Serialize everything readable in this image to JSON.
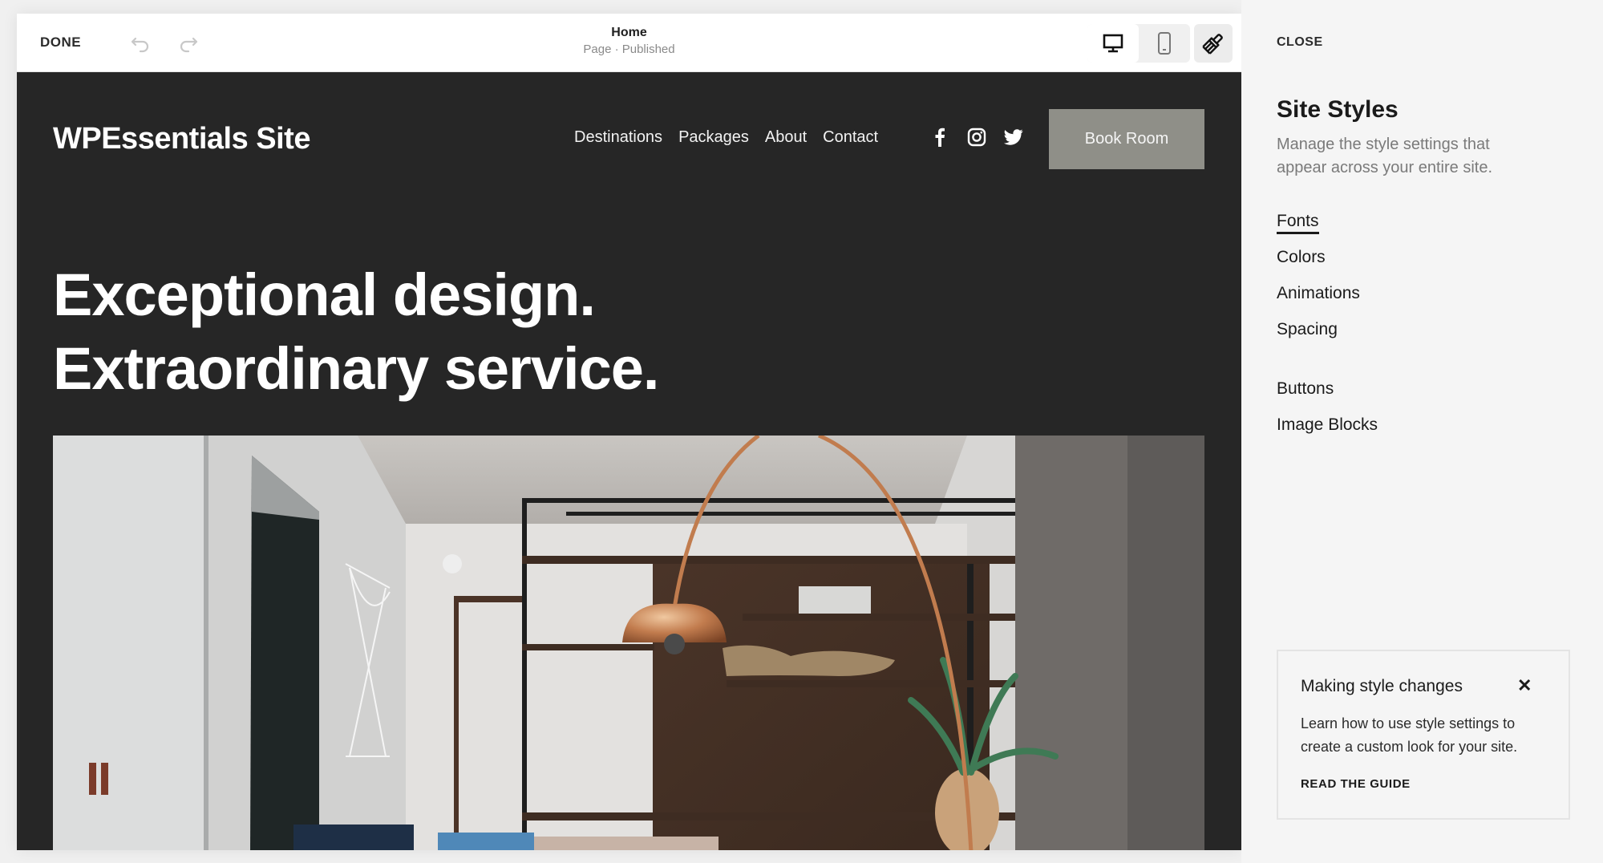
{
  "toolbar": {
    "done_label": "DONE",
    "page_title": "Home",
    "page_status": "Page · Published",
    "undo_icon": "undo-icon",
    "redo_icon": "redo-icon",
    "device_views": [
      {
        "name": "desktop",
        "icon": "desktop-icon",
        "active": true
      },
      {
        "name": "mobile",
        "icon": "mobile-icon",
        "active": false
      }
    ],
    "style_icon": "paintbrush-icon"
  },
  "site": {
    "title": "WPEssentials Site",
    "nav": [
      "Destinations",
      "Packages",
      "About",
      "Contact"
    ],
    "social": [
      "facebook-icon",
      "instagram-icon",
      "twitter-icon"
    ],
    "cta_label": "Book Room",
    "hero_line1": "Exceptional design.",
    "hero_line2": "Extraordinary service.",
    "hero_image_alt": "Modern living room with copper arc floor lamp, wooden shelving and plant",
    "colors": {
      "background": "#262626",
      "button": "#8f8f88",
      "text": "#ffffff"
    }
  },
  "panel": {
    "close_label": "CLOSE",
    "title": "Site Styles",
    "description": "Manage the style settings that appear across your entire site.",
    "menu_group1": [
      "Fonts",
      "Colors",
      "Animations",
      "Spacing"
    ],
    "menu_group2": [
      "Buttons",
      "Image Blocks"
    ],
    "active_item": "Fonts",
    "tip": {
      "title": "Making style changes",
      "body": "Learn how to use style settings to create a custom look for your site.",
      "link": "READ THE GUIDE"
    }
  }
}
